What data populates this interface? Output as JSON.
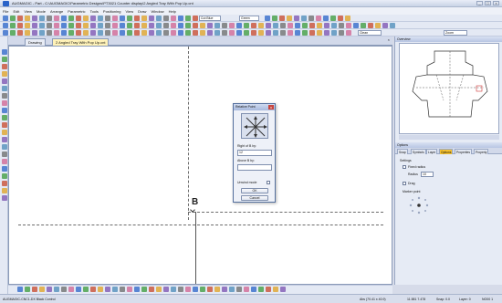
{
  "window": {
    "title": "AUGMAGIC - Part - C:\\AUGMAGIC\\Parametric Designs\\PT3021 Counter display\\2 Angled Tray With Pop Up.cnt"
  },
  "menu": [
    "File",
    "Edit",
    "View",
    "Mode",
    "Arrange",
    "Parametric",
    "Tools",
    "Positioning",
    "View",
    "Draw",
    "Window",
    "Help"
  ],
  "toolbar": {
    "layer_combo": "Cut Blue",
    "style_combo": "Green",
    "extra_combo": "Clean",
    "zoom_combo": "Zoom"
  },
  "doc_tabs": [
    "Drawing",
    "2 Angled Tray With Pop Up.cnt"
  ],
  "canvas": {
    "point_label": "B"
  },
  "dialog": {
    "title": "Relative Point",
    "close": "x",
    "right_label": "Right of B by:",
    "right_value": "12",
    "above_label": "Above B by:",
    "above_value": "",
    "unwind_label": "Unwind mode",
    "ok": "OK",
    "cancel": "Cancel"
  },
  "right_panel": {
    "overview_title": "Overview",
    "options_title": "Options",
    "tabs": [
      "Snap",
      "Symbols",
      "Layer",
      "Options",
      "Properties",
      "Property"
    ],
    "settings_label": "Settings",
    "fixed_radius_label": "Fixed radius",
    "radius_label": "Radius",
    "radius_value": "10",
    "drag_label": "Drag",
    "marker_label": "Marker point"
  },
  "status": {
    "left": "AUGMAGIC-CNC1-DX Black Control",
    "coords": "Abs (70.41 x 40.9)",
    "dims": "11.581  7.478",
    "snap": "Snap: 0.0",
    "layer": "Layer: 0",
    "scale": "NO00  1"
  },
  "colors": {
    "accent": "#2a63c8",
    "dialog_header": "#a7b9dd",
    "highlight_tab": "#f6c12e"
  }
}
